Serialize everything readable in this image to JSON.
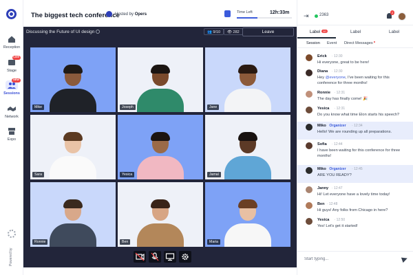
{
  "header": {
    "title": "The biggest tech conference",
    "hosted_by_prefix": "Hosted by",
    "hosted_by_name": "Opers",
    "time_left_label": "Time Left",
    "time_left_value": "12h:33m"
  },
  "nav": {
    "items": [
      {
        "label": "Reception",
        "icon": "home-icon"
      },
      {
        "label": "Stage",
        "icon": "stage-icon",
        "badge": "LIVE"
      },
      {
        "label": "Sessions",
        "icon": "sessions-icon",
        "badge": "NEW",
        "active": true
      },
      {
        "label": "Network",
        "icon": "handshake-icon"
      },
      {
        "label": "Expo",
        "icon": "expo-icon"
      }
    ],
    "powered_by": "Powered by"
  },
  "stage": {
    "title": "Discussing the Future of UI design",
    "participants": "9/10",
    "viewers": "282",
    "leave_label": "Leave",
    "tiles": [
      {
        "name": "Mike",
        "bg": "#7ea2f6",
        "skin": "#8a5a3c",
        "hair": "#1f1a17",
        "shirt": "#1f2228"
      },
      {
        "name": "Joseph",
        "bg": "#eef1f8",
        "skin": "#7a4a2c",
        "hair": "#1b1512",
        "shirt": "#2f8a6a"
      },
      {
        "name": "Jane",
        "bg": "#c9d8fb",
        "skin": "#8c5a3a",
        "hair": "#2a1a12",
        "shirt": "#f3f4f6"
      },
      {
        "name": "Sara",
        "bg": "#eef1f8",
        "skin": "#e9c3a6",
        "hair": "#5b3a22",
        "shirt": "#fafafa"
      },
      {
        "name": "Yesica",
        "bg": "#7ea2f6",
        "skin": "#9a6a48",
        "hair": "#1c1410",
        "shirt": "#f1b8c2"
      },
      {
        "name": "Jamal",
        "bg": "#eef1f8",
        "skin": "#5c3a26",
        "hair": "#181210",
        "shirt": "#5fa6d6"
      },
      {
        "name": "Ronnie",
        "bg": "#c9d8fb",
        "skin": "#d8a88a",
        "hair": "#3a2a1e",
        "shirt": "#3f4a5c"
      },
      {
        "name": "Ben",
        "bg": "#eef1f8",
        "skin": "#d7a584",
        "hair": "#3a2418",
        "shirt": "#b3875a"
      },
      {
        "name": "Maria",
        "bg": "#7ea2f6",
        "skin": "#e8c0a3",
        "hair": "#6b3f24",
        "shirt": "#f7f7f7"
      }
    ],
    "controls": [
      {
        "icon": "camera-off-icon",
        "glyph": "⊘"
      },
      {
        "icon": "mic-off-icon",
        "glyph": "✕"
      },
      {
        "icon": "screen-share-icon",
        "glyph": "▭"
      },
      {
        "icon": "settings-icon",
        "glyph": "⚙"
      }
    ]
  },
  "panel": {
    "online_count": "2363",
    "notification_count": "2",
    "tabs": [
      {
        "label": "Label",
        "badge": "10"
      },
      {
        "label": "Label"
      },
      {
        "label": "Label"
      }
    ],
    "subtabs": [
      "Session",
      "Event",
      "Direct Messages"
    ],
    "messages": [
      {
        "name": "Erick",
        "time": "12:30",
        "text": "Hi everyone, great to be here!",
        "avatar": "#7c4a2a"
      },
      {
        "name": "Diana",
        "time": "12:30",
        "text_before": "Hey ",
        "mention": "@everyone",
        "text_after": ", I've been waiting for this conference for three months!",
        "avatar": "#3b2a26"
      },
      {
        "name": "Ronnie",
        "time": "12:31",
        "text": "The day has finally come! 🎉",
        "avatar": "#c0907a"
      },
      {
        "name": "Yesica",
        "time": "12:31",
        "text": "Do you know what time Elon starts his speech?",
        "avatar": "#6d4c3a"
      },
      {
        "name": "Miko",
        "role": "Organizer",
        "time": "12:34",
        "text": "Hello! We are rounding up all preparations.",
        "avatar": "#2b2b2b",
        "highlight": true
      },
      {
        "name": "Sofia",
        "time": "12:44",
        "text": "I have been waiting for this conference for three months!",
        "avatar": "#5a3b2e"
      },
      {
        "name": "Miko",
        "role": "Organizer",
        "time": "12:45",
        "text": "ARE YOU READY?",
        "avatar": "#2b2b2b",
        "highlight": true
      },
      {
        "name": "Janny",
        "time": "12:47",
        "text": "Hi! Let everyone have a lovely time today!",
        "avatar": "#a98470"
      },
      {
        "name": "Ben",
        "time": "12:48",
        "text": "Hi guys! Any folks from Chicago in here?",
        "avatar": "#b07a5a"
      },
      {
        "name": "Yesica",
        "time": "12:50",
        "text": "Yes! Let's get it started!",
        "avatar": "#6d4c3a"
      }
    ],
    "composer_placeholder": "Start typing..."
  }
}
